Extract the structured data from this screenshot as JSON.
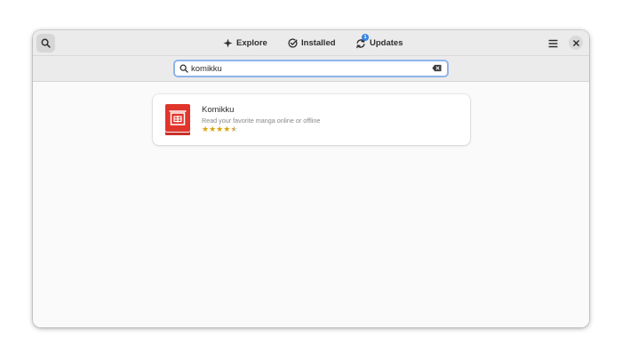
{
  "header": {
    "tabs": [
      {
        "label": "Explore",
        "icon": "explore-icon"
      },
      {
        "label": "Installed",
        "icon": "installed-check-icon"
      },
      {
        "label": "Updates",
        "icon": "updates-icon",
        "badge": "1"
      }
    ]
  },
  "search": {
    "value": "komikku",
    "placeholder": ""
  },
  "results": [
    {
      "name": "Komikku",
      "summary": "Read your favorite manga online or offline",
      "rating": 4.5,
      "rating_max": 5,
      "icon": "komikku-app-icon"
    }
  ],
  "colors": {
    "accent": "#3584e4",
    "app_icon_red": "#e0352b",
    "star": "#d9a30f"
  }
}
